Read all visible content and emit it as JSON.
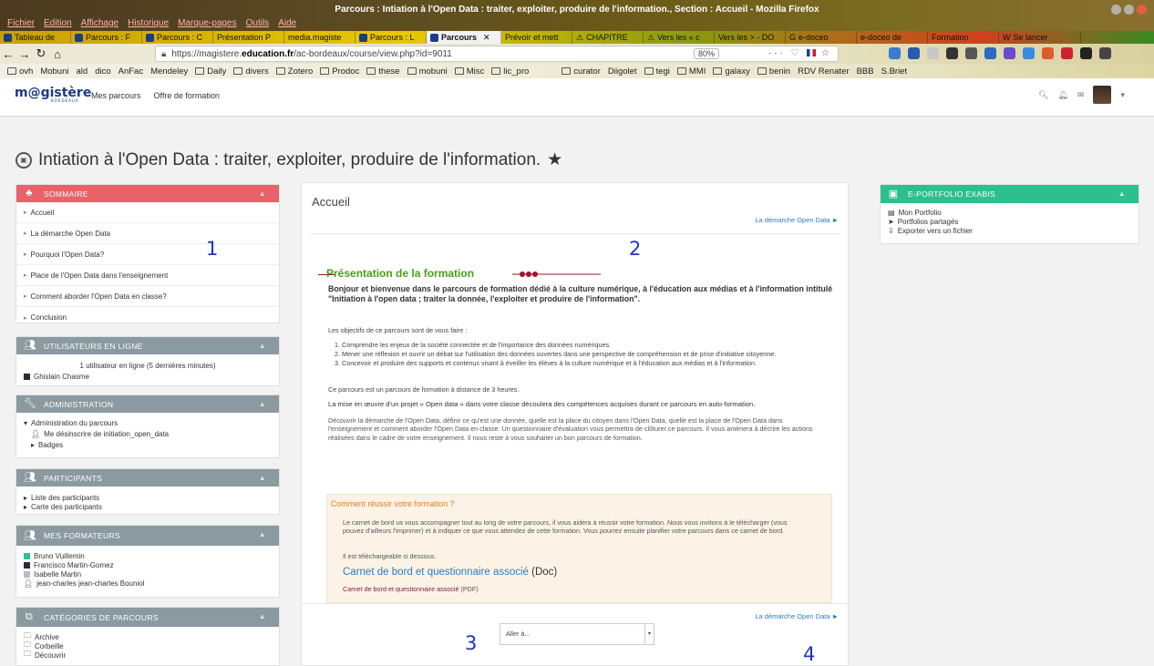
{
  "window": {
    "title": "Parcours : Intiation à l'Open Data : traiter, exploiter, produire de l'information., Section : Accueil - Mozilla Firefox",
    "menu": [
      "Fichier",
      "Edition",
      "Affichage",
      "Historique",
      "Marque-pages",
      "Outils",
      "Aide"
    ]
  },
  "tabs": [
    "Tableau de",
    "Parcours : F",
    "Parcours : C",
    "Présentation P",
    "media.magiste",
    "Parcours : L",
    "Parcours",
    "Prévoir et mett",
    "CHAPITRE",
    "Vers les « c",
    "Vers les > - DO",
    "e-doceo",
    "e-doceo de",
    "Formation",
    "Se lancer"
  ],
  "active_tab_index": 6,
  "address": {
    "prefix": "https://magistere.",
    "domain": "education.fr",
    "path": "/ac-bordeaux/course/view.php?id=9011",
    "zoom": "80%"
  },
  "bookmarks": [
    "ovh",
    "Mobuni",
    "ald",
    "dico",
    "AnFac",
    "Mendeley",
    "Daily",
    "divers",
    "Zotero",
    "Prodoc",
    "these",
    "mobuni",
    "Misc",
    "lic_pro",
    "curator",
    "Diigolet",
    "tegi",
    "MMI",
    "galaxy",
    "benin",
    "RDV Renater",
    "BBB",
    "S.Briet"
  ],
  "site": {
    "logo": "m@gistère",
    "logo_sub": "BORDEAUX",
    "nav": [
      "Mes parcours",
      "Offre de formation"
    ]
  },
  "course_title": "Intiation à l'Open Data : traiter, exploiter, produire de l'information.",
  "sommaire": {
    "title": "SOMMAIRE",
    "items": [
      "Accueil",
      "La démarche Open Data",
      "Pourquoi l'Open Data?",
      "Place de l'Open Data dans l'enseignement",
      "Comment aborder l'Open Data en classe?",
      "Conclusion"
    ]
  },
  "online_users": {
    "title": "UTILISATEURS EN LIGNE",
    "summary": "1 utilisateur en ligne (5 dernières minutes)",
    "user": "Ghislain Chasme"
  },
  "admin": {
    "title": "ADMINISTRATION",
    "root": "Administration du parcours",
    "items": [
      "Me désinscrire de initiation_open_data",
      "Badges"
    ]
  },
  "participants": {
    "title": "PARTICIPANTS",
    "items": [
      "Liste des participants",
      "Carte des participants"
    ]
  },
  "formateurs": {
    "title": "MES FORMATEURS",
    "items": [
      "Bruno Vuillemin",
      "Francisco Martin-Gomez",
      "Isabelle Martin",
      "jean-charles jean-charles Bouniol"
    ]
  },
  "categories": {
    "title": "CATÉGORIES DE PARCOURS",
    "items": [
      "Archive",
      "Corbeille",
      "Découvrir"
    ]
  },
  "eportfolio": {
    "title": "E-PORTFOLIO EXABIS",
    "items": [
      "Mon Portfolio",
      "Portfolios partagés",
      "Exporter vers un fichier"
    ]
  },
  "centre": {
    "heading": "Accueil",
    "next_link": "La démarche Open Data ►",
    "pres_title": "Présentation de la formation",
    "intro": "Bonjour et bienvenue dans le parcours de formation dédié à la culture numérique, à l'éducation aux médias et à l'information intitulé \"Initiation à l'open data ; traiter la donnée, l'exploiter et produire de l'information\".",
    "objectives_head": "Les objectifs de ce parcours sont de vous faire :",
    "objectives": [
      "Comprendre les enjeux de la société connectée et de l'importance des données numériques.",
      "Mener une réflexion et ouvrir un débat sur l'utilisation des données ouvertes dans une perspective de compréhension et de prise d'initiative citoyenne.",
      "Concevoir et produire des supports et contenus visant à éveiller les élèves à la culture numérique et à l'éducation aux médias et à l'information."
    ],
    "duration": "Ce parcours est un parcours de formation à distance de 3 heures.",
    "project": "La mise en œuvre d'un projet « Open data » dans votre classe découlera des compétences acquises durant ce parcours en auto-formation.",
    "discover": "Découvrir la démarche de l'Open Data, définir ce qu'est une donnée, quelle est la place du citoyen dans l'Open Data, quelle est la place de l'Open Data dans l'enseignement et comment aborder l'Open Data en classe. Un questionnaire d'évaluation vous permettra de clôturer ce parcours. Il vous amènera à décrire les actions réalisées dans le cadre de votre enseignement. Il nous reste à vous souhaiter un bon parcours de formation.",
    "reussir": {
      "title": "Comment réussir votre formation ?",
      "text": "Le carnet de bord va vous accompagner tout au long de votre parcours, il vous aidera à réussir votre formation. Nous vous invitons à le télécharger (vous pouvez d'ailleurs l'imprimer) et à indiquer ce que vous attendez de cette formation. Vous pourrez ensuite planifier votre parcours dans ce carnet de bord.",
      "download": "Il est téléchargeable ci dessous.",
      "doc_link": "Carnet de bord et questionnaire associé",
      "doc_suffix": "(Doc)",
      "pdf_link": "Carnet de bord et questionnaire associé",
      "pdf_suffix": "(PDF)"
    },
    "jump_placeholder": "Aller à..."
  },
  "annotations": [
    "1",
    "2",
    "3",
    "4"
  ]
}
